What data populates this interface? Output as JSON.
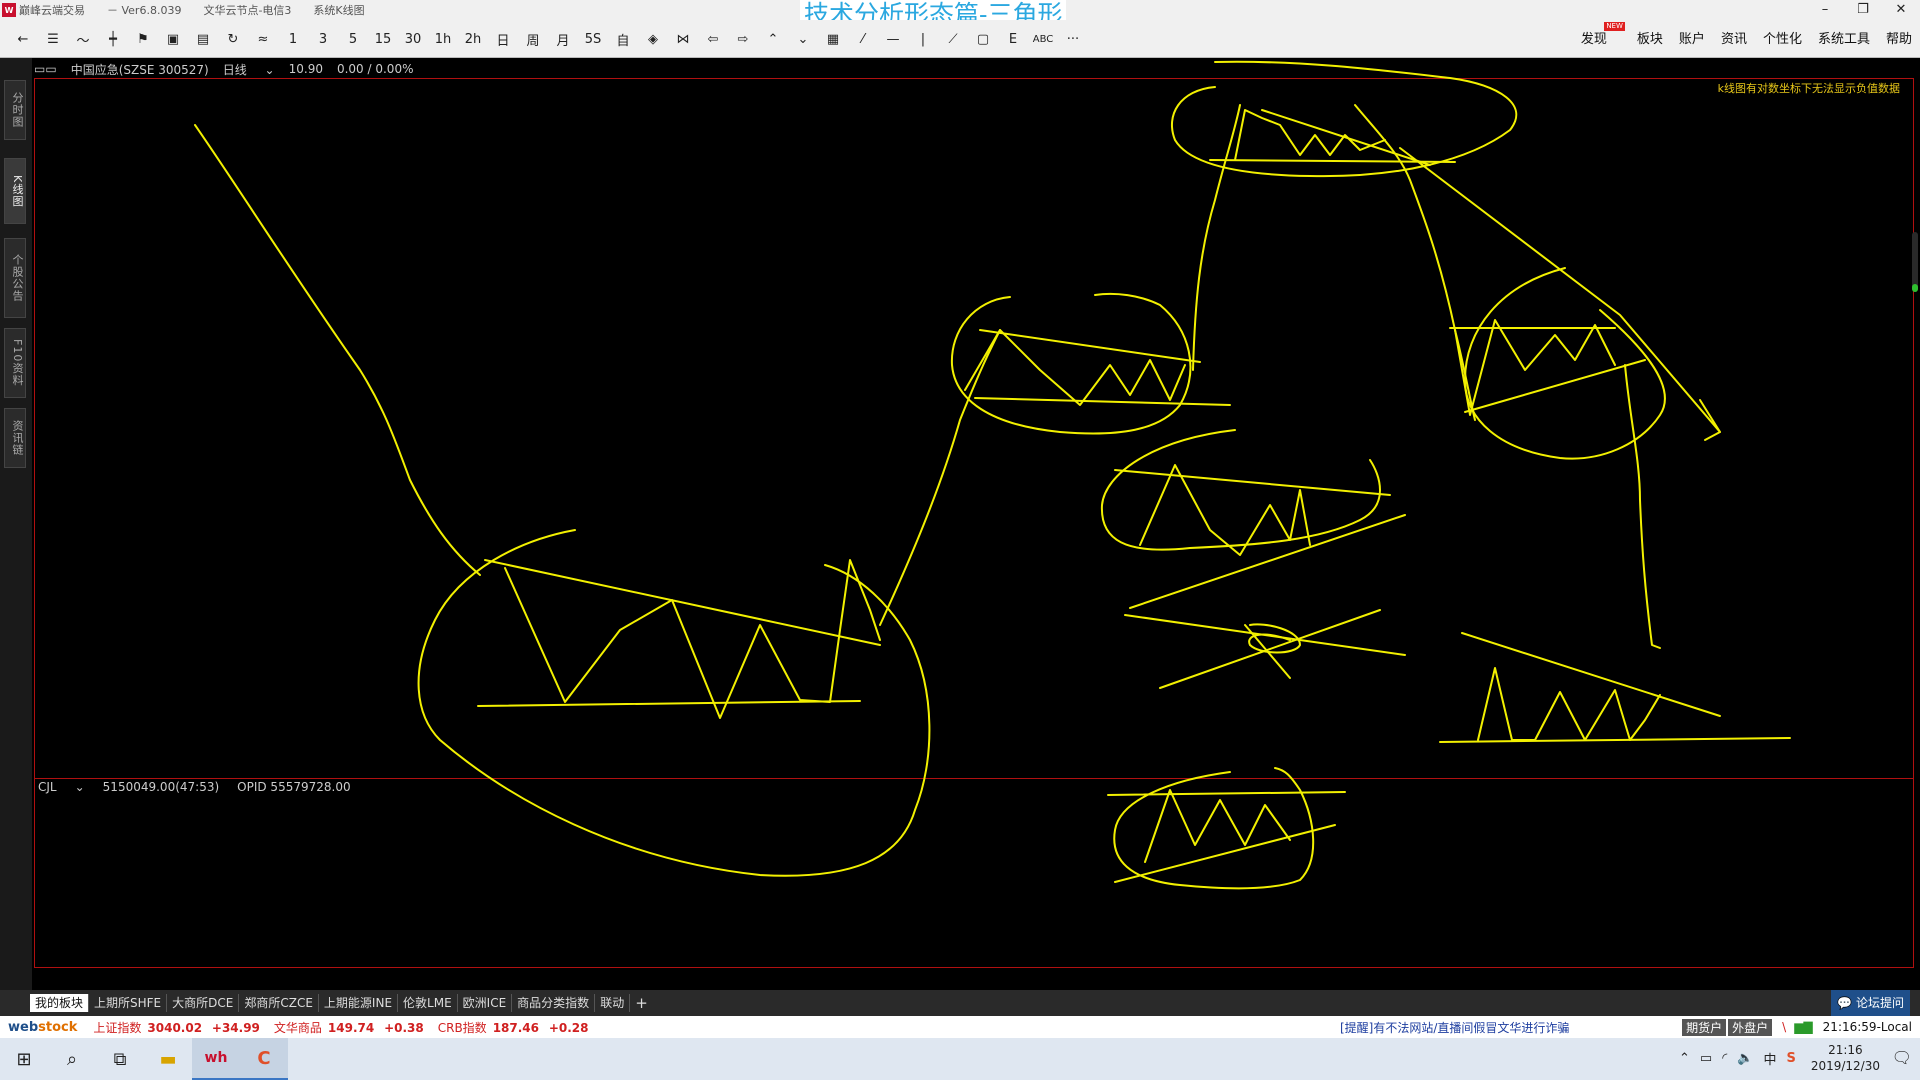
{
  "window": {
    "app_name": "巅峰云端交易",
    "version": "－ Ver6.8.039",
    "server": "文华云节点-电信3",
    "layout": "系统K线图",
    "controls": [
      "–",
      "❐",
      "✕"
    ]
  },
  "overlay_title": "技术分析形态篇-三角形",
  "toolbar": {
    "icons": [
      "arrow-left-icon",
      "list-icon",
      "line-chart-icon",
      "candle-icon",
      "flag-icon",
      "board-icon",
      "save-icon",
      "refresh-icon",
      "compare-icon"
    ],
    "periods": [
      "1",
      "3",
      "5",
      "15",
      "30",
      "1h",
      "2h",
      "日",
      "周",
      "月",
      "5S",
      "自"
    ],
    "drawing_icons": [
      "eye-icon",
      "hourglass-icon",
      "left-arrow-icon",
      "right-arrow-icon",
      "up-chevron-icon",
      "down-chevron-icon",
      "grid-icon",
      "pencil-icon",
      "hline-icon",
      "vline-icon",
      "ray-icon",
      "rect-icon",
      "fib-icon"
    ],
    "text_tool": "ABC",
    "more": "···",
    "menu": [
      "发现",
      "板块",
      "账户",
      "资讯",
      "个性化",
      "系统工具",
      "帮助"
    ],
    "new_badge": "NEW"
  },
  "left_tabs": [
    "分时图",
    "K线图",
    "个股公告",
    "F10资料",
    "资讯链"
  ],
  "chart": {
    "symbol": "中国应急(SZSE 300527)",
    "period": "日线",
    "price": "10.90",
    "change": "0.00 / 0.00%",
    "warning": "k线图有对数坐标下无法显示负值数据",
    "vol_label": "CJL",
    "vol_value": "5150049.00(47:53)",
    "opid": "OPID 55579728.00"
  },
  "market_tabs": [
    "我的板块",
    "上期所SHFE",
    "大商所DCE",
    "郑商所CZCE",
    "上期能源INE",
    "伦敦LME",
    "欧洲ICE",
    "商品分类指数",
    "联动",
    "+"
  ],
  "forum": "论坛提问",
  "status": {
    "logo_a": "web",
    "logo_b": "stock",
    "indices": [
      {
        "name": "上证指数",
        "value": "3040.02",
        "change": "+34.99"
      },
      {
        "name": "文华商品",
        "value": "149.74",
        "change": "+0.38"
      },
      {
        "name": "CRB指数",
        "value": "187.46",
        "change": "+0.28"
      }
    ],
    "notice": "[提醒]有不法网站/直播间假冒文华进行诈骗",
    "buttons": [
      "期货户",
      "外盘户"
    ],
    "time": "21:16:59-Local"
  },
  "taskbar": {
    "clock_time": "21:16",
    "clock_date": "2019/12/30"
  },
  "colors": {
    "drawing": "#f2f000",
    "frame": "#b01010",
    "overlay_title": "#2ba8e0"
  }
}
